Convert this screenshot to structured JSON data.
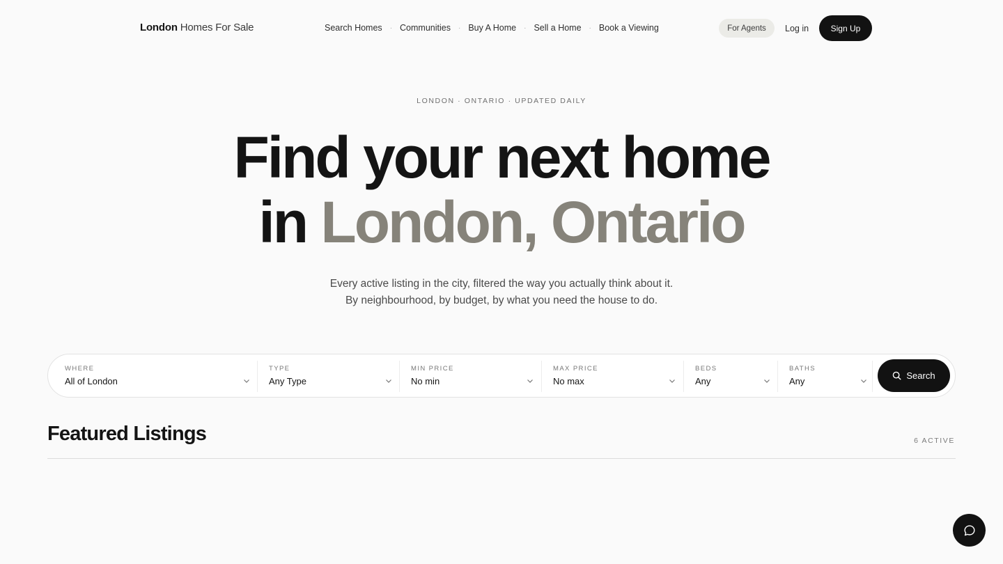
{
  "header": {
    "brand_bold": "London",
    "brand_light": "Homes For Sale",
    "nav": [
      {
        "label": "Search Homes"
      },
      {
        "label": "Communities"
      },
      {
        "label": "Buy A Home"
      },
      {
        "label": "Sell a Home"
      },
      {
        "label": "Book a Viewing"
      }
    ],
    "nav_separator": "·",
    "agents_label": "For Agents",
    "login_label": "Log in",
    "signup_label": "Sign Up"
  },
  "hero": {
    "eyebrow": "LONDON · ONTARIO · UPDATED DAILY",
    "headline_line1": "Find your next home",
    "headline_line2_prefix": "in ",
    "headline_line2_accent": "London, Ontario",
    "subtext": "Every active listing in the city, filtered the way you actually think about it. By neighbourhood, by budget, by what you need the house to do."
  },
  "search": {
    "fields": [
      {
        "label": "WHERE",
        "value": "All of London"
      },
      {
        "label": "TYPE",
        "value": "Any Type"
      },
      {
        "label": "MIN PRICE",
        "value": "No min"
      },
      {
        "label": "MAX PRICE",
        "value": "No max"
      },
      {
        "label": "BEDS",
        "value": "Any"
      },
      {
        "label": "BATHS",
        "value": "Any"
      }
    ],
    "button_label": "Search",
    "button_icon": "search-icon",
    "field_icon": "chevron-down-icon"
  },
  "featured": {
    "title": "Featured Listings",
    "count": "6 ACTIVE"
  },
  "chat": {
    "icon": "chat-bubble-icon"
  },
  "colors": {
    "background": "#fafafa",
    "primary": "#121212",
    "accent_text": "#86837a",
    "agents_pill": "#ebebe7"
  }
}
